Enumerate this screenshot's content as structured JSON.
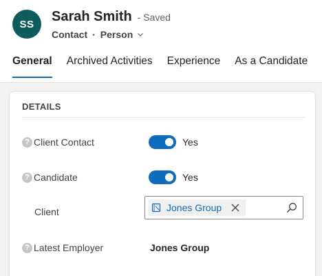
{
  "record": {
    "initials": "SS",
    "name": "Sarah Smith",
    "save_status": "- Saved",
    "entity": "Contact",
    "separator": "·",
    "form_name": "Person"
  },
  "tabs": [
    {
      "label": "General",
      "active": true
    },
    {
      "label": "Archived Activities",
      "active": false
    },
    {
      "label": "Experience",
      "active": false
    },
    {
      "label": "As a Candidate",
      "active": false
    }
  ],
  "details": {
    "section_title": "DETAILS",
    "client_contact": {
      "label": "Client Contact",
      "value": "Yes",
      "on": true
    },
    "candidate": {
      "label": "Candidate",
      "value": "Yes",
      "on": true
    },
    "client": {
      "label": "Client",
      "lookup_value": "Jones Group"
    },
    "latest_employer": {
      "label": "Latest Employer",
      "value": "Jones Group"
    }
  },
  "colors": {
    "avatar": "#0f5c5c",
    "accent": "#0f6cbd",
    "help_icon": "#c8c6c4",
    "page_background": "#f3f2f1"
  },
  "icons": {
    "help": "?",
    "form_selector": "chevron-down-icon",
    "lookup_entity": "account-record-icon",
    "lookup_remove": "close-icon",
    "lookup_search": "search-icon"
  }
}
